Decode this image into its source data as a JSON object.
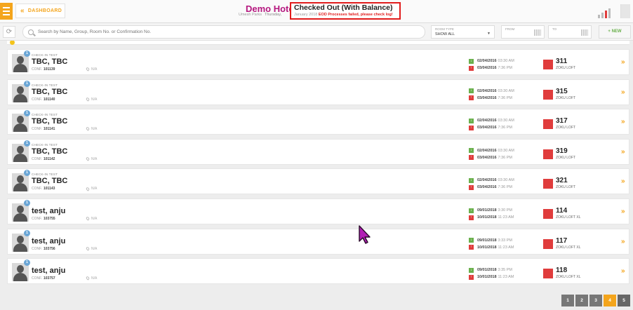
{
  "header": {
    "dashboard_label": "DASHBOARD",
    "hotel_name": "Demo Hotel",
    "hotel_user": "Umesh Parks",
    "hotel_day": "Thursday,",
    "status_title": "Checked Out (With Balance)",
    "status_date": "January 2018",
    "status_error": "EOD Processes failed, please check log!"
  },
  "filters": {
    "search_placeholder": "Search by Name, Group, Room No. or Confirmation No.",
    "room_type_label": "ROOM TYPE",
    "room_type_value": "SHOW ALL",
    "from_label": "FROM",
    "to_label": "TO",
    "new_label": "+ NEW"
  },
  "rows": [
    {
      "badge": "1",
      "group": "CHECK-IN TEST",
      "guest": "TBC, TBC",
      "conf_label": "CONF.",
      "conf": "101139",
      "location": "N/A",
      "in_date": "02/04/2016",
      "in_time": "03:30 AM",
      "out_date": "03/04/2016",
      "out_time": "7:36 PM",
      "room": "311",
      "room_type": "ZOKU LOFT"
    },
    {
      "badge": "1",
      "group": "CHECK-IN TEST",
      "guest": "TBC, TBC",
      "conf_label": "CONF.",
      "conf": "101140",
      "location": "N/A",
      "in_date": "02/04/2016",
      "in_time": "03:30 AM",
      "out_date": "03/04/2016",
      "out_time": "7:36 PM",
      "room": "315",
      "room_type": "ZOKU LOFT"
    },
    {
      "badge": "1",
      "group": "CHECK-IN TEST",
      "guest": "TBC, TBC",
      "conf_label": "CONF.",
      "conf": "101141",
      "location": "N/A",
      "in_date": "02/04/2016",
      "in_time": "03:30 AM",
      "out_date": "03/04/2016",
      "out_time": "7:36 PM",
      "room": "317",
      "room_type": "ZOKU LOFT"
    },
    {
      "badge": "1",
      "group": "CHECK-IN TEST",
      "guest": "TBC, TBC",
      "conf_label": "CONF.",
      "conf": "101142",
      "location": "N/A",
      "in_date": "02/04/2016",
      "in_time": "03:30 AM",
      "out_date": "03/04/2016",
      "out_time": "7:36 PM",
      "room": "319",
      "room_type": "ZOKU LOFT"
    },
    {
      "badge": "1",
      "group": "CHECK-IN TEST",
      "guest": "TBC, TBC",
      "conf_label": "CONF.",
      "conf": "101143",
      "location": "N/A",
      "in_date": "02/04/2016",
      "in_time": "03:30 AM",
      "out_date": "03/04/2016",
      "out_time": "7:36 PM",
      "room": "321",
      "room_type": "ZOKU LOFT"
    },
    {
      "badge": "1",
      "group": "",
      "guest": "test, anju",
      "conf_label": "CONF.",
      "conf": "103755",
      "location": "N/A",
      "in_date": "09/01/2018",
      "in_time": "3:30 PM",
      "out_date": "10/01/2018",
      "out_time": "11:23 AM",
      "room": "114",
      "room_type": "ZOKU LOFT XL"
    },
    {
      "badge": "1",
      "group": "",
      "guest": "test, anju",
      "conf_label": "CONF.",
      "conf": "103756",
      "location": "N/A",
      "in_date": "09/01/2018",
      "in_time": "3:33 PM",
      "out_date": "10/01/2018",
      "out_time": "11:23 AM",
      "room": "117",
      "room_type": "ZOKU LOFT XL"
    },
    {
      "badge": "1",
      "group": "",
      "guest": "test, anju",
      "conf_label": "CONF.",
      "conf": "103757",
      "location": "N/A",
      "in_date": "09/01/2018",
      "in_time": "3:35 PM",
      "out_date": "10/01/2018",
      "out_time": "11:23 AM",
      "room": "118",
      "room_type": "ZOKU LOFT XL"
    }
  ],
  "pager": {
    "pages": [
      "1",
      "2",
      "3",
      "4",
      "5"
    ],
    "active": "4"
  },
  "colors": {
    "accent": "#f4a51c",
    "brand": "#b5177f",
    "room_status": "#e03c3c",
    "arrival": "#6ab04c",
    "departure": "#e03c3c",
    "error": "#e11b1b"
  }
}
